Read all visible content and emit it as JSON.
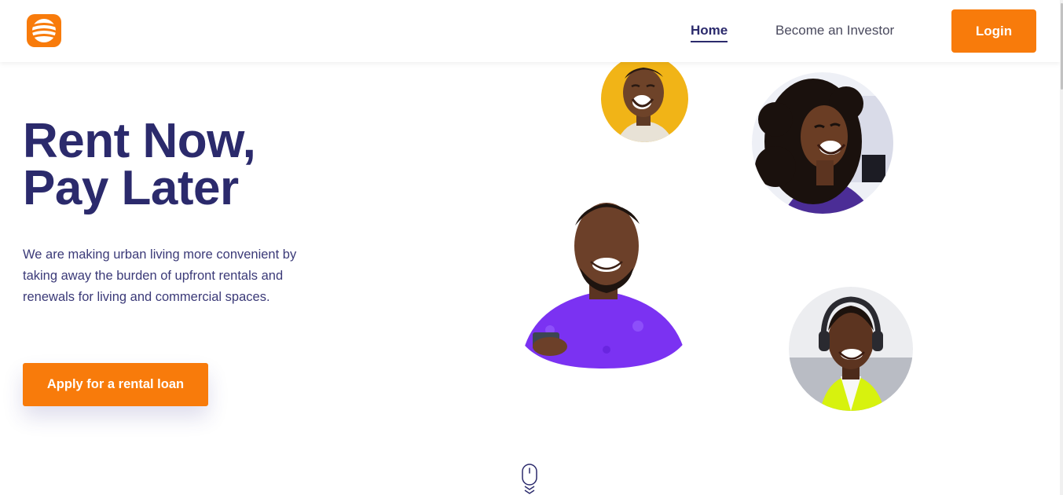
{
  "header": {
    "logo_icon": "stacked-waves-logo-icon",
    "nav": {
      "home": "Home",
      "investor": "Become an Investor"
    },
    "login_label": "Login"
  },
  "hero": {
    "title_line1": "Rent Now,",
    "title_line2": "Pay Later",
    "description": "We are making urban living more convenient by taking away the burden of upfront rentals and renewals for living and commercial spaces.",
    "cta_label": "Apply for a rental loan"
  },
  "photos": [
    {
      "name": "smiling-woman-yellow-backdrop-photo"
    },
    {
      "name": "laughing-woman-curly-hair-photo"
    },
    {
      "name": "smiling-man-purple-shirt-photo"
    },
    {
      "name": "smiling-man-headphones-photo"
    }
  ],
  "scroll_indicator_icon": "mouse-scroll-down-icon",
  "colors": {
    "brand_orange": "#f87b0b",
    "brand_navy": "#2b2a6c",
    "text_body": "#3b3a78",
    "header_bg": "#ffffff"
  }
}
